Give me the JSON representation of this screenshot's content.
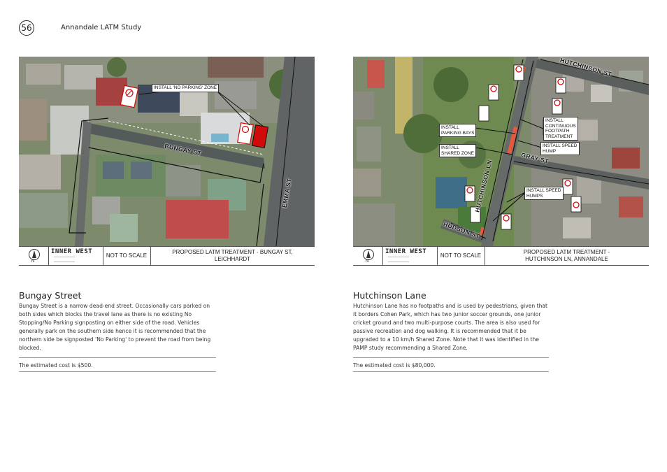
{
  "header": {
    "page_number": "56",
    "document_title": "Annandale LATM Study"
  },
  "left_panel": {
    "callouts": {
      "no_parking_zone": "INSTALL 'NO PARKING' ZONE"
    },
    "streets": {
      "bungay": "BUNGAY ST",
      "emma": "EMMA ST"
    },
    "legend": {
      "north": "N",
      "logo": "INNER WEST",
      "scale": "NOT TO SCALE",
      "title": "PROPOSED LATM TREATMENT - BUNGAY ST,\nLEICHHARDT"
    }
  },
  "right_panel": {
    "callouts": {
      "parking_bays": "INSTALL\nPARKING BAYS",
      "shared_zone": "INSTALL\nSHARED ZONE",
      "continuous_footpath": "INSTALL\nCONTINUOUS\nFOOTPATH\nTREATMENT",
      "speed_hump": "INSTALL SPEED\nHUMP",
      "speed_humps": "INSTALL SPEED\nHUMPS"
    },
    "streets": {
      "hutchinson_st": "HUTCHINSON ST",
      "gray_st": "GRAY ST",
      "hutchinson_ln": "HUTCHINSON LN",
      "hudson_st": "HUDSON ST"
    },
    "legend": {
      "north": "N",
      "logo": "INNER WEST",
      "scale": "NOT TO SCALE",
      "title": "PROPOSED LATM TREATMENT -\nHUTCHINSON LN, ANNANDALE"
    }
  },
  "bungay_section": {
    "heading": "Bungay Street",
    "body": "Bungay Street is a narrow dead-end street. Occasionally cars parked on both sides which blocks the travel lane as there is no existing No Stopping/No Parking signposting on either side of the road. Vehicles generally park on the southern side hence it is recommended that the northern side be signposted 'No Parking' to prevent the road from being blocked.",
    "cost": "The estimated cost is $500."
  },
  "hutchinson_section": {
    "heading": "Hutchinson Lane",
    "body": "Hutchinson Lane has no footpaths and is used by pedestrians, given that it borders Cohen Park, which has two junior soccer grounds, one junior cricket ground and two multi-purpose courts. The area is also used for passive recreation and dog walking. It is recommended that it be upgraded to a 10 km/h Shared Zone.   Note that it was identified in the PAMP study recommending a Shared Zone.",
    "cost": "The estimated cost is $80,000."
  }
}
